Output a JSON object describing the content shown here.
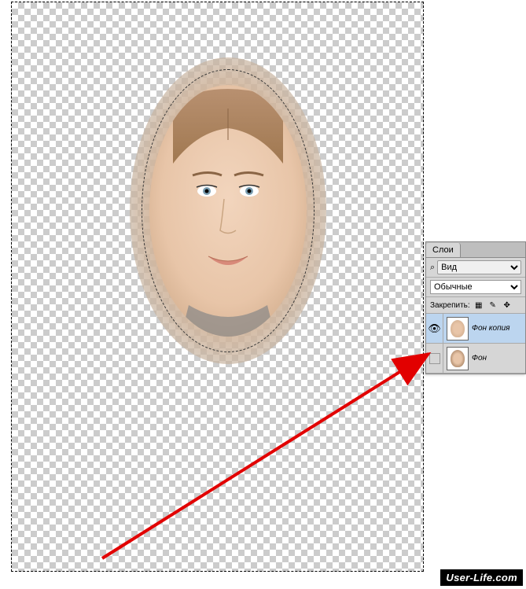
{
  "panel": {
    "tab_label": "Слои",
    "view_label": "Вид",
    "blend_mode": "Обычные",
    "lock_label": "Закрепить:"
  },
  "layers": [
    {
      "name": "Фон копия",
      "visible": true,
      "selected": true
    },
    {
      "name": "Фон",
      "visible": false,
      "selected": false
    }
  ],
  "watermark": "User-Life.com"
}
